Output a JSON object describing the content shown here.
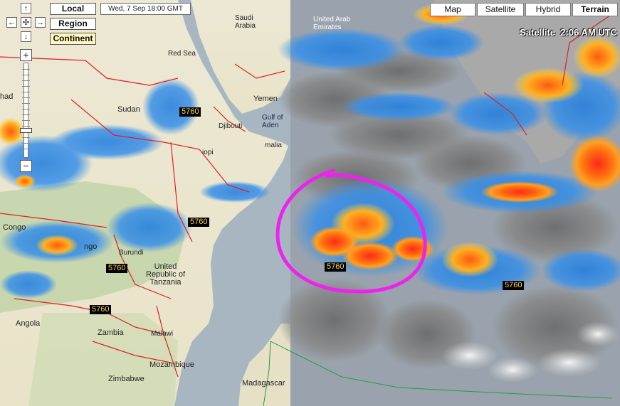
{
  "nav": {
    "up": "↑",
    "down": "↓",
    "left": "←",
    "right": "→",
    "center": "✣",
    "zoom_in": "+",
    "zoom_out": "−"
  },
  "scale_buttons": {
    "local": "Local",
    "region": "Region",
    "continent": "Continent"
  },
  "timestamp": "Wed, 7 Sep 18:00 GMT",
  "map_types": {
    "map": "Map",
    "satellite": "Satellite",
    "hybrid": "Hybrid",
    "terrain": "Terrain"
  },
  "satellite_time": "Satellite  2:06 AM UTC",
  "contour_labels": {
    "c1": "5760",
    "c2": "5760",
    "c3": "5760",
    "c4": "5760",
    "c5": "5760",
    "c6": "5760"
  },
  "places": {
    "saudi_arabia": "Saudi\nArabia",
    "uae": "United Arab\nEmirates",
    "red_sea": "Red Sea",
    "yemen": "Yemen",
    "sudan": "Sudan",
    "chad": "had",
    "djibouti": "Djibouti",
    "gulf_of_aden": "Gulf of\nAden",
    "somalia": "malia",
    "ethiopia": "iopi",
    "congo": "Congo",
    "congo2": "ngo",
    "burundi": "Burundi",
    "tanzania": "United\nRepublic of\nTanzania",
    "angola": "Angola",
    "zambia": "Zambia",
    "malawi": "Malawi",
    "mozambique": "Mozambique",
    "zimbabwe": "Zimbabwe",
    "madagascar": "Madagascar"
  },
  "colors": {
    "highlight_circle": "#ee22ee",
    "border_lines": "#e02020",
    "ocean": "#a8b6c2",
    "land": "#ede9d8"
  }
}
